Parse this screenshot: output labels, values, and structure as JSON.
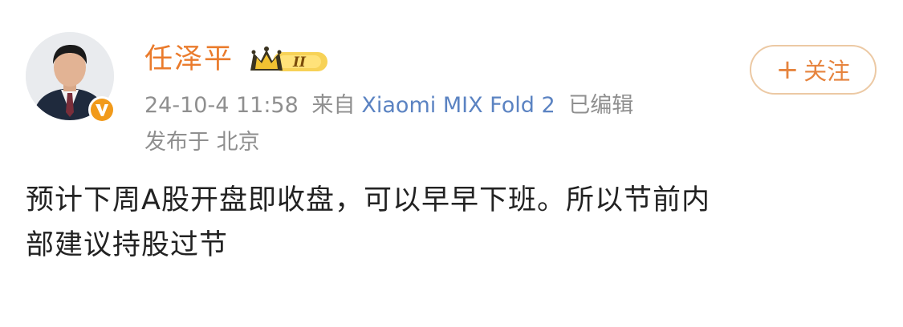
{
  "user": {
    "name": "任泽平",
    "badge_level": "II"
  },
  "meta": {
    "datetime": "24-10-4 11:58",
    "from_label": "来自",
    "device": "Xiaomi MIX Fold 2",
    "edited": "已编辑",
    "location": "发布于 北京"
  },
  "follow": {
    "plus": "+",
    "label": "关注"
  },
  "post": {
    "line1": "预计下周A股开盘即收盘，可以早早下班。所以节前内",
    "line2": "部建议持股过节"
  },
  "colors": {
    "name": "#ea7b2c",
    "follow": "#e6843e",
    "meta": "#8f8f8f",
    "device": "#5b83c2",
    "text": "#222222"
  }
}
